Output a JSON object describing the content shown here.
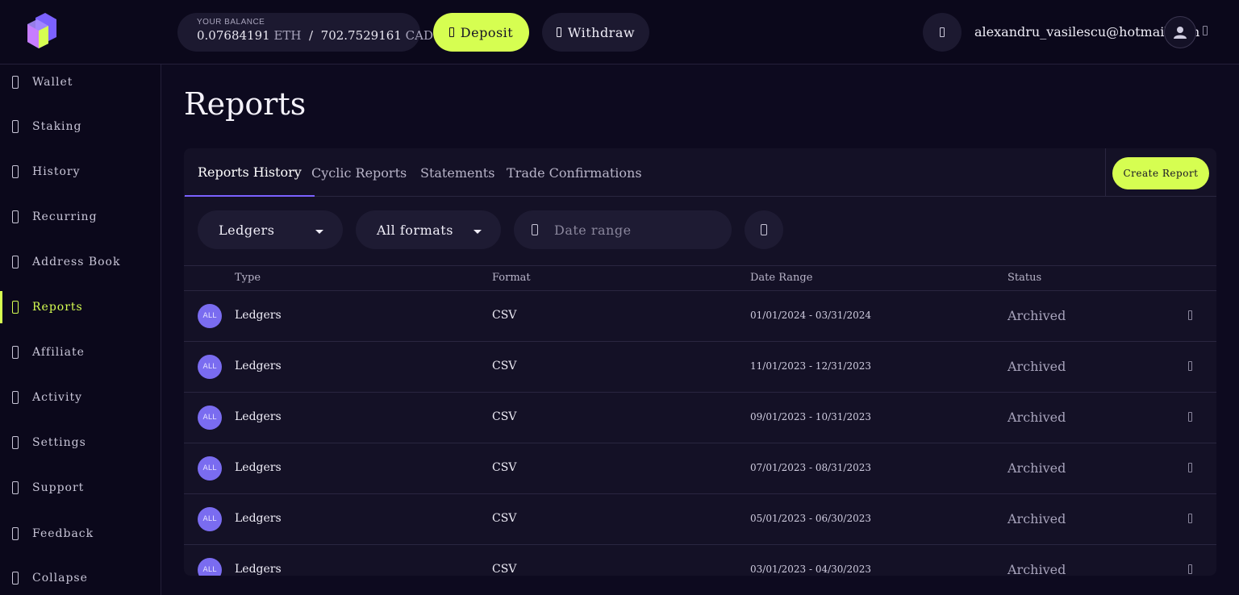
{
  "header": {
    "balance_label": "YOUR BALANCE",
    "eth_amount": "0.07684191",
    "eth_unit": "ETH",
    "separator": "/",
    "cad_amount": "702.7529161",
    "cad_unit": "CAD",
    "deposit_label": "Deposit",
    "withdraw_label": "Withdraw",
    "user_email": "alexandru_vasilescu@hotmail.com",
    "accent_color": "#d6fe51"
  },
  "sidebar": {
    "items": [
      {
        "label": "Wallet",
        "icon": "wallet-icon"
      },
      {
        "label": "Staking",
        "icon": "staking-icon"
      },
      {
        "label": "History",
        "icon": "history-icon"
      },
      {
        "label": "Recurring",
        "icon": "recurring-icon"
      },
      {
        "label": "Address Book",
        "icon": "address-book-icon"
      },
      {
        "label": "Reports",
        "icon": "reports-icon",
        "active": true
      },
      {
        "label": "Affiliate",
        "icon": "affiliate-icon"
      },
      {
        "label": "Activity",
        "icon": "activity-icon"
      },
      {
        "label": "Settings",
        "icon": "settings-icon"
      },
      {
        "label": "Support",
        "icon": "support-icon"
      },
      {
        "label": "Feedback",
        "icon": "feedback-icon"
      },
      {
        "label": "Collapse",
        "icon": "collapse-icon"
      }
    ]
  },
  "main": {
    "title": "Reports",
    "tabs": [
      {
        "label": "Reports History",
        "active": true
      },
      {
        "label": "Cyclic Reports"
      },
      {
        "label": "Statements"
      },
      {
        "label": "Trade Confirmations"
      }
    ],
    "create_report_label": "Create Report",
    "filters": {
      "type_selected": "Ledgers",
      "format_selected": "All formats",
      "date_placeholder": "Date range"
    },
    "table": {
      "columns": [
        "Type",
        "Format",
        "Date Range",
        "Status"
      ],
      "rows": [
        {
          "badge": "ALL",
          "type": "Ledgers",
          "format": "CSV",
          "range": "01/01/2024 - 03/31/2024",
          "status": "Archived"
        },
        {
          "badge": "ALL",
          "type": "Ledgers",
          "format": "CSV",
          "range": "11/01/2023 - 12/31/2023",
          "status": "Archived"
        },
        {
          "badge": "ALL",
          "type": "Ledgers",
          "format": "CSV",
          "range": "09/01/2023 - 10/31/2023",
          "status": "Archived"
        },
        {
          "badge": "ALL",
          "type": "Ledgers",
          "format": "CSV",
          "range": "07/01/2023 - 08/31/2023",
          "status": "Archived"
        },
        {
          "badge": "ALL",
          "type": "Ledgers",
          "format": "CSV",
          "range": "05/01/2023 - 06/30/2023",
          "status": "Archived"
        },
        {
          "badge": "ALL",
          "type": "Ledgers",
          "format": "CSV",
          "range": "03/01/2023 - 04/30/2023",
          "status": "Archived"
        }
      ]
    }
  }
}
